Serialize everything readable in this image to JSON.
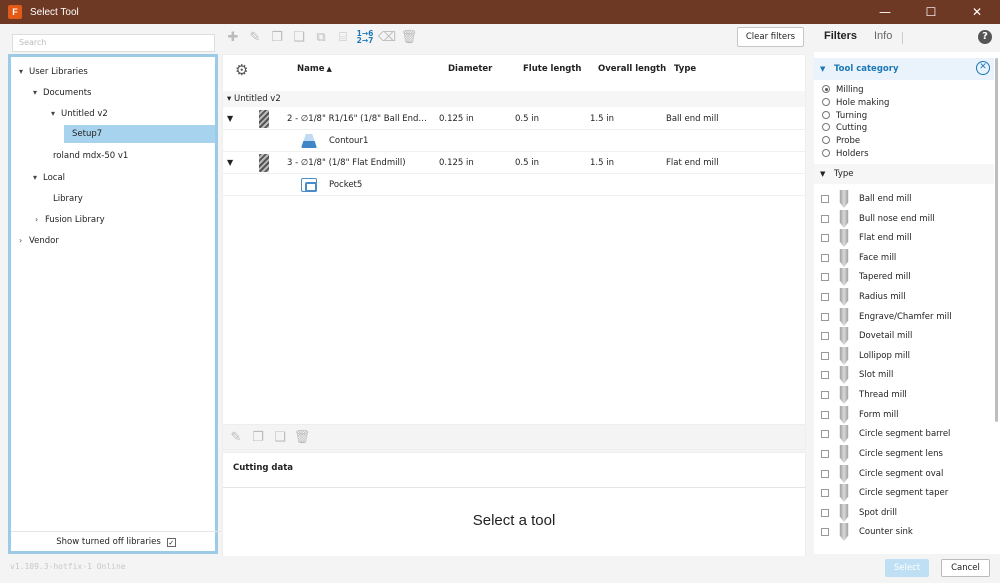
{
  "window": {
    "title": "Select Tool",
    "app_icon": "F",
    "minimize": "—",
    "maximize": "☐",
    "close": "✕"
  },
  "left": {
    "search_placeholder": "Search",
    "tree": [
      {
        "label": "User Libraries",
        "toggle": "▾"
      },
      {
        "label": "Documents",
        "toggle": "▾"
      },
      {
        "label": "Untitled v2",
        "toggle": "▾"
      },
      {
        "label": "Setup7",
        "toggle": "",
        "selected": true
      },
      {
        "label": "roland mdx-50 v1",
        "toggle": ""
      },
      {
        "label": "Local",
        "toggle": "▾"
      },
      {
        "label": "Library",
        "toggle": ""
      },
      {
        "label": "Fusion Library",
        "toggle": "›"
      },
      {
        "label": "Vendor",
        "toggle": "›"
      }
    ],
    "show_turned_off": "Show turned off libraries",
    "show_turned_off_checked": "✓"
  },
  "toolbar": {
    "icons": [
      "add-icon",
      "edit-icon",
      "copy-icon",
      "paste-icon",
      "duplicate-icon",
      "holder-icon",
      "renumber-icon",
      "brush-icon",
      "delete-icon"
    ],
    "renumber_label_top": "1→6",
    "renumber_label_bottom": "2→7",
    "clear_filters": "Clear filters"
  },
  "table": {
    "columns": {
      "name": "Name",
      "diameter": "Diameter",
      "flute": "Flute length",
      "overall": "Overall length",
      "type": "Type"
    },
    "group": "Untitled v2",
    "rows": [
      {
        "name": "2 - ∅1/8\" R1/16\" (1/8\" Ball End…",
        "diameter": "0.125 in",
        "flute": "0.5 in",
        "overall": "1.5 in",
        "type": "Ball end mill",
        "operation": "Contour1"
      },
      {
        "name": "3 - ∅1/8\" (1/8\" Flat Endmill)",
        "diameter": "0.125 in",
        "flute": "0.5 in",
        "overall": "1.5 in",
        "type": "Flat end mill",
        "operation": "Pocket5"
      }
    ]
  },
  "cutting": {
    "title": "Cutting data",
    "empty_message": "Select a tool"
  },
  "right": {
    "tab_filters": "Filters",
    "tab_info": "Info",
    "help": "?",
    "category_header": "Tool category",
    "categories": [
      "Milling",
      "Hole making",
      "Turning",
      "Cutting",
      "Probe",
      "Holders"
    ],
    "selected_category": "Milling",
    "type_header": "Type",
    "types": [
      "Ball end mill",
      "Bull nose end mill",
      "Flat end mill",
      "Face mill",
      "Tapered mill",
      "Radius mill",
      "Engrave/Chamfer mill",
      "Dovetail mill",
      "Lollipop mill",
      "Slot mill",
      "Thread mill",
      "Form mill",
      "Circle segment barrel",
      "Circle segment lens",
      "Circle segment oval",
      "Circle segment taper",
      "Spot drill",
      "Counter sink"
    ]
  },
  "footer": {
    "version": "v1.109.3-hotfix-1 Online",
    "select": "Select",
    "cancel": "Cancel"
  },
  "colors": {
    "accent": "#1c78b8",
    "titlebar": "#6e3924",
    "selection": "#a8d3ee"
  }
}
